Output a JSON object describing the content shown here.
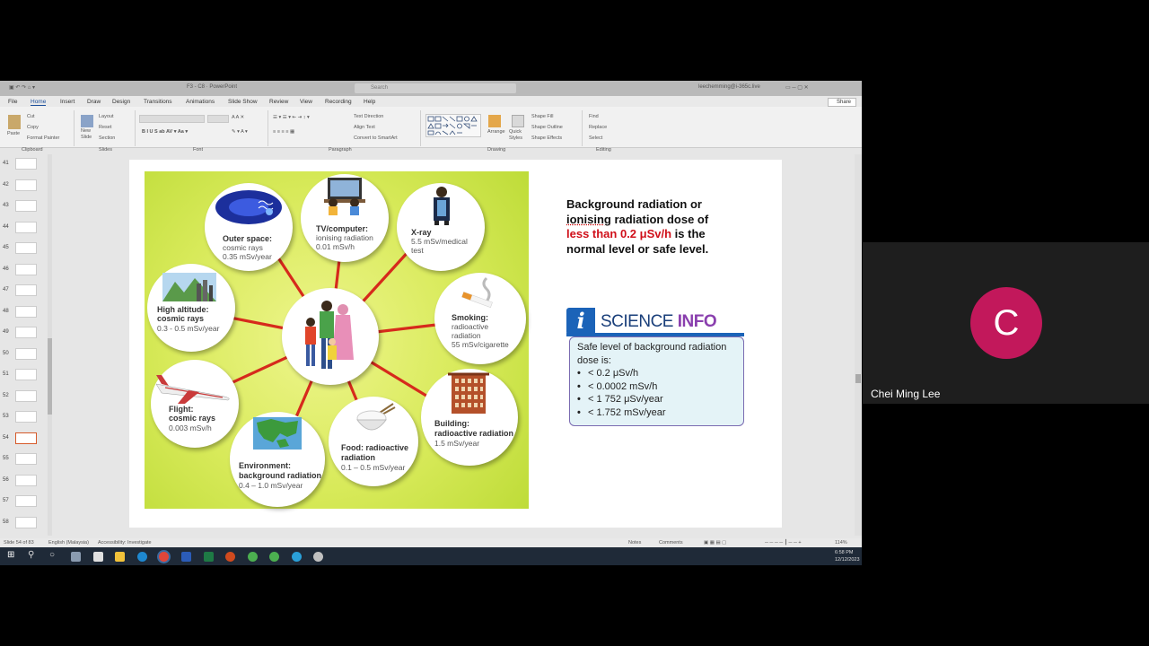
{
  "window": {
    "doc_title": "F3 - C8  ·  PowerPoint",
    "search_placeholder": "Search",
    "user": "leechemming@i-365c.live",
    "share_label": "Share"
  },
  "menu": [
    "File",
    "Home",
    "Insert",
    "Draw",
    "Design",
    "Transitions",
    "Animations",
    "Slide Show",
    "Review",
    "View",
    "Recording",
    "Help"
  ],
  "ribbon": {
    "clipboard": {
      "paste": "Paste",
      "cut": "Cut",
      "copy": "Copy",
      "format_painter": "Format Painter",
      "group": "Clipboard"
    },
    "slides": {
      "new_slide": "New Slide",
      "layout": "Layout",
      "reset": "Reset",
      "section": "Section",
      "group": "Slides"
    },
    "font": {
      "group": "Font"
    },
    "paragraph": {
      "text_direction": "Text Direction",
      "align_text": "Align Text",
      "convert_smartart": "Convert to SmartArt",
      "group": "Paragraph"
    },
    "drawing": {
      "arrange": "Arrange",
      "quick_styles": "Quick Styles",
      "shape_fill": "Shape Fill",
      "shape_outline": "Shape Outline",
      "shape_effects": "Shape Effects",
      "group": "Drawing"
    },
    "editing": {
      "find": "Find",
      "replace": "Replace",
      "select": "Select",
      "group": "Editing"
    }
  },
  "thumbnails": [
    {
      "num": "41"
    },
    {
      "num": "42"
    },
    {
      "num": "43"
    },
    {
      "num": "44"
    },
    {
      "num": "45"
    },
    {
      "num": "46"
    },
    {
      "num": "47"
    },
    {
      "num": "48"
    },
    {
      "num": "49"
    },
    {
      "num": "50"
    },
    {
      "num": "51"
    },
    {
      "num": "52"
    },
    {
      "num": "53"
    },
    {
      "num": "54",
      "selected": true
    },
    {
      "num": "55"
    },
    {
      "num": "56"
    },
    {
      "num": "57"
    },
    {
      "num": "58"
    }
  ],
  "slide": {
    "bubbles": {
      "outer_space": {
        "title": "Outer space:",
        "lines": [
          "cosmic rays",
          "0.35 mSv/year"
        ]
      },
      "tv": {
        "title": "TV/computer:",
        "lines": [
          "ionising radiation",
          "0.01 mSv/h"
        ]
      },
      "xray": {
        "title": "X-ray",
        "lines": [
          "5.5 mSv/medical",
          "test"
        ]
      },
      "high_alt": {
        "title": "High altitude:",
        "title2": "cosmic rays",
        "lines": [
          "0.3 - 0.5 mSv/year"
        ]
      },
      "smoking": {
        "title": "Smoking:",
        "title2": "radioactive",
        "title3": "radiation",
        "lines": [
          "55 mSv/cigarette"
        ]
      },
      "flight": {
        "title": "Flight:",
        "title2": "cosmic rays",
        "lines": [
          "0.003 mSv/h"
        ]
      },
      "building": {
        "title": "Building:",
        "title2": "radioactive radiation",
        "lines": [
          "1.5 mSv/year"
        ]
      },
      "environment": {
        "title": "Environment:",
        "title2": "background radiation",
        "lines": [
          "0.4 – 1.0 mSv/year"
        ]
      },
      "food": {
        "title": "Food: radioactive",
        "title2": "radiation",
        "lines": [
          "0.1 – 0.5 mSv/year"
        ]
      }
    },
    "text": {
      "line1": "Background radiation or",
      "line2a": "ionising",
      "line2b": " radiation dose of",
      "line3_red": "less than 0.2 μSv/h",
      "line3b": " is the",
      "line4": "normal level or safe level."
    },
    "science_info": {
      "i": "i",
      "science": "SCIENCE",
      "info": "INFO",
      "intro": "Safe level of background radiation dose is:",
      "items": [
        "< 0.2 μSv/h",
        "< 0.0002 mSv/h",
        "< 1 752 μSv/year",
        "< 1.752 mSv/year"
      ]
    }
  },
  "status": {
    "slide_of": "Slide 54 of 83",
    "language": "English (Malaysia)",
    "accessibility": "Accessibility: Investigate",
    "notes": "Notes",
    "comments": "Comments",
    "zoom": "114%"
  },
  "clock": {
    "time": "6:58 PM",
    "date": "12/12/2023"
  },
  "participant": {
    "initial": "C",
    "name": "Chei Ming Lee"
  }
}
